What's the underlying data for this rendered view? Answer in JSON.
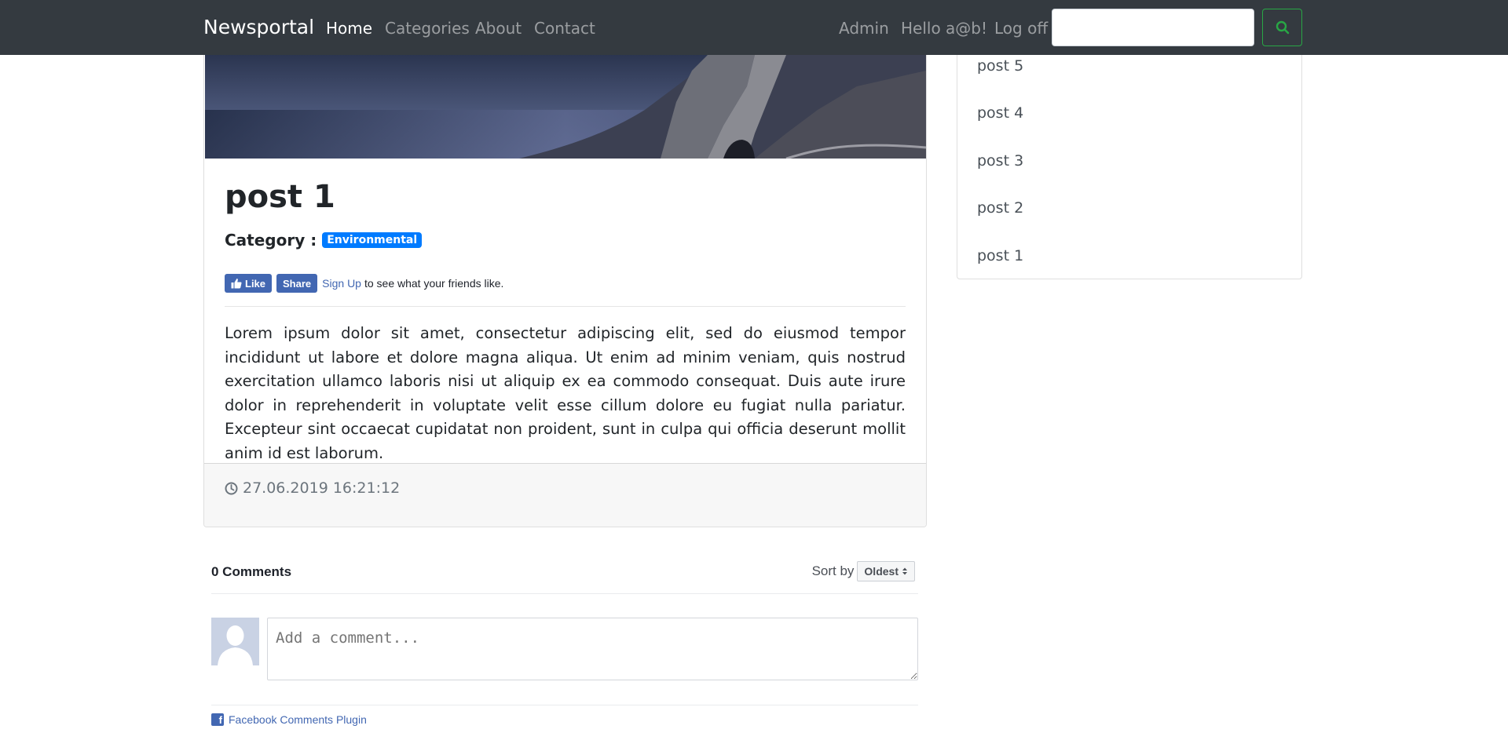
{
  "navbar": {
    "brand": "Newsportal",
    "links": [
      {
        "label": "Home",
        "active": true
      },
      {
        "label": "Categories",
        "active": false
      },
      {
        "label": "About",
        "active": false
      },
      {
        "label": "Contact",
        "active": false
      }
    ],
    "right_links": [
      {
        "label": "Admin"
      },
      {
        "label": "Hello a@b!"
      },
      {
        "label": "Log off"
      }
    ],
    "search": {
      "placeholder": "",
      "button_icon": "search-icon"
    },
    "colors": {
      "bg": "#343a40",
      "search_accent": "#28a745"
    }
  },
  "post": {
    "title": "post 1",
    "category_label": "Category :",
    "category": "Environmental",
    "facebook": {
      "like_label": "Like",
      "share_label": "Share",
      "signup_label": "Sign Up",
      "signup_text": "to see what your friends like."
    },
    "body": "Lorem ipsum dolor sit amet, consectetur adipiscing elit, sed do eiusmod tempor incididunt ut labore et dolore magna aliqua. Ut enim ad minim veniam, quis nostrud exercitation ullamco laboris nisi ut aliquip ex ea commodo consequat. Duis aute irure dolor in reprehenderit in voluptate velit esse cillum dolore eu fugiat nulla pariatur. Excepteur sint occaecat cupidatat non proident, sunt in culpa qui officia deserunt mollit anim id est laborum.",
    "timestamp": "27.06.2019 16:21:12"
  },
  "sidebar": {
    "items": [
      {
        "label": "post 5"
      },
      {
        "label": "post 4"
      },
      {
        "label": "post 3"
      },
      {
        "label": "post 2"
      },
      {
        "label": "post 1"
      }
    ]
  },
  "comments": {
    "count_label": "0 Comments",
    "sort_label": "Sort by",
    "sort_value": "Oldest",
    "input_placeholder": "Add a comment...",
    "plugin_label": "Facebook Comments Plugin"
  }
}
